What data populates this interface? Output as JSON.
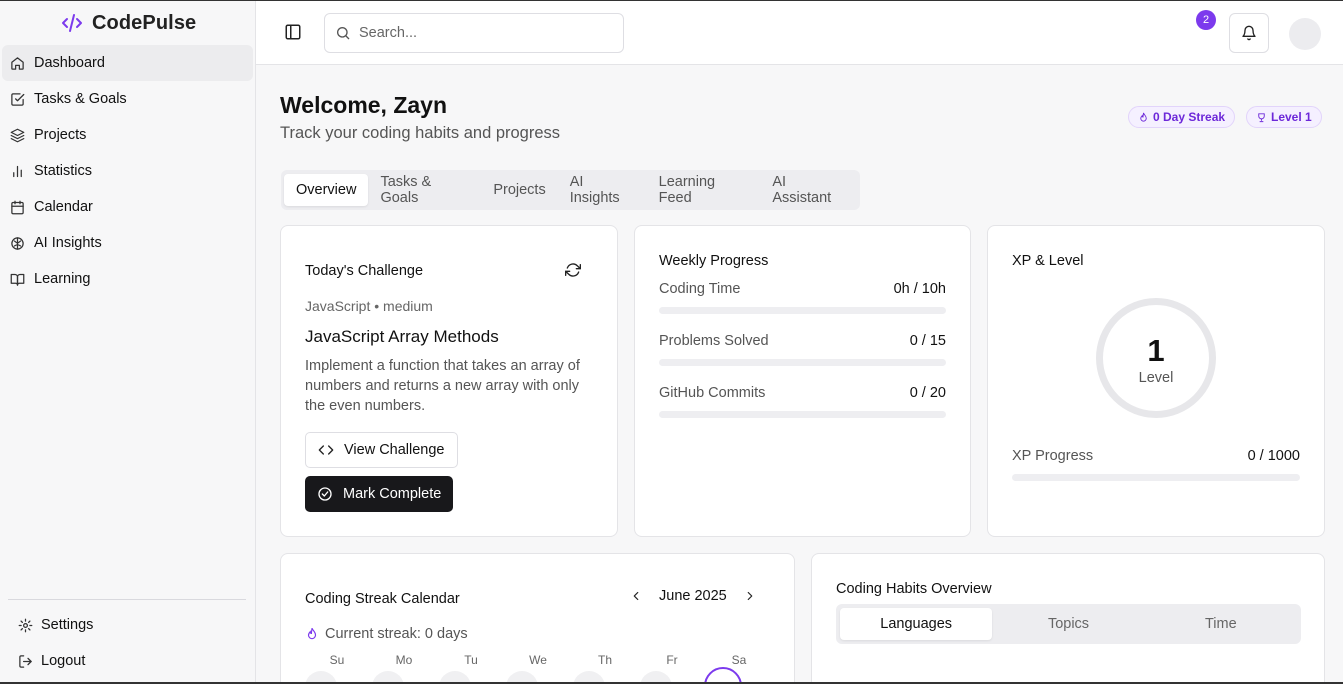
{
  "app": {
    "name": "CodePulse",
    "accent": "#7c3aed"
  },
  "sidebar": {
    "items": [
      {
        "label": "Dashboard",
        "icon": "home-icon"
      },
      {
        "label": "Tasks & Goals",
        "icon": "check-square-icon"
      },
      {
        "label": "Projects",
        "icon": "layers-icon"
      },
      {
        "label": "Statistics",
        "icon": "bar-chart-icon"
      },
      {
        "label": "Calendar",
        "icon": "calendar-icon"
      },
      {
        "label": "AI Insights",
        "icon": "brain-icon"
      },
      {
        "label": "Learning",
        "icon": "book-open-icon"
      }
    ],
    "bottom": [
      {
        "label": "Settings",
        "icon": "gear-icon"
      },
      {
        "label": "Logout",
        "icon": "logout-icon"
      }
    ]
  },
  "header": {
    "search_placeholder": "Search...",
    "notification_count": "2"
  },
  "welcome": {
    "title": "Welcome, Zayn",
    "subtitle": "Track your coding habits and progress",
    "streak_pill": "0 Day Streak",
    "level_pill": "Level 1"
  },
  "tabs": [
    "Overview",
    "Tasks & Goals",
    "Projects",
    "AI Insights",
    "Learning Feed",
    "AI Assistant"
  ],
  "challenge": {
    "title": "Today's Challenge",
    "meta": "JavaScript • medium",
    "name": "JavaScript Array Methods",
    "description": "Implement a function that takes an array of numbers and returns a new array with only the even numbers.",
    "view_label": "View Challenge",
    "complete_label": "Mark Complete"
  },
  "weekly": {
    "title": "Weekly Progress",
    "rows": [
      {
        "label": "Coding Time",
        "value": "0h / 10h",
        "progress": 0
      },
      {
        "label": "Problems Solved",
        "value": "0 / 15",
        "progress": 0
      },
      {
        "label": "GitHub Commits",
        "value": "0 / 20",
        "progress": 0
      }
    ]
  },
  "xp": {
    "title": "XP & Level",
    "level": "1",
    "level_label": "Level",
    "progress_label": "XP Progress",
    "progress_value": "0 / 1000",
    "progress": 0
  },
  "calendar": {
    "title": "Coding Streak Calendar",
    "month": "June 2025",
    "streak_text": "Current streak: 0 days",
    "days": [
      "Su",
      "Mo",
      "Tu",
      "We",
      "Th",
      "Fr",
      "Sa"
    ]
  },
  "habits": {
    "title": "Coding Habits Overview",
    "segments": [
      "Languages",
      "Topics",
      "Time"
    ]
  }
}
